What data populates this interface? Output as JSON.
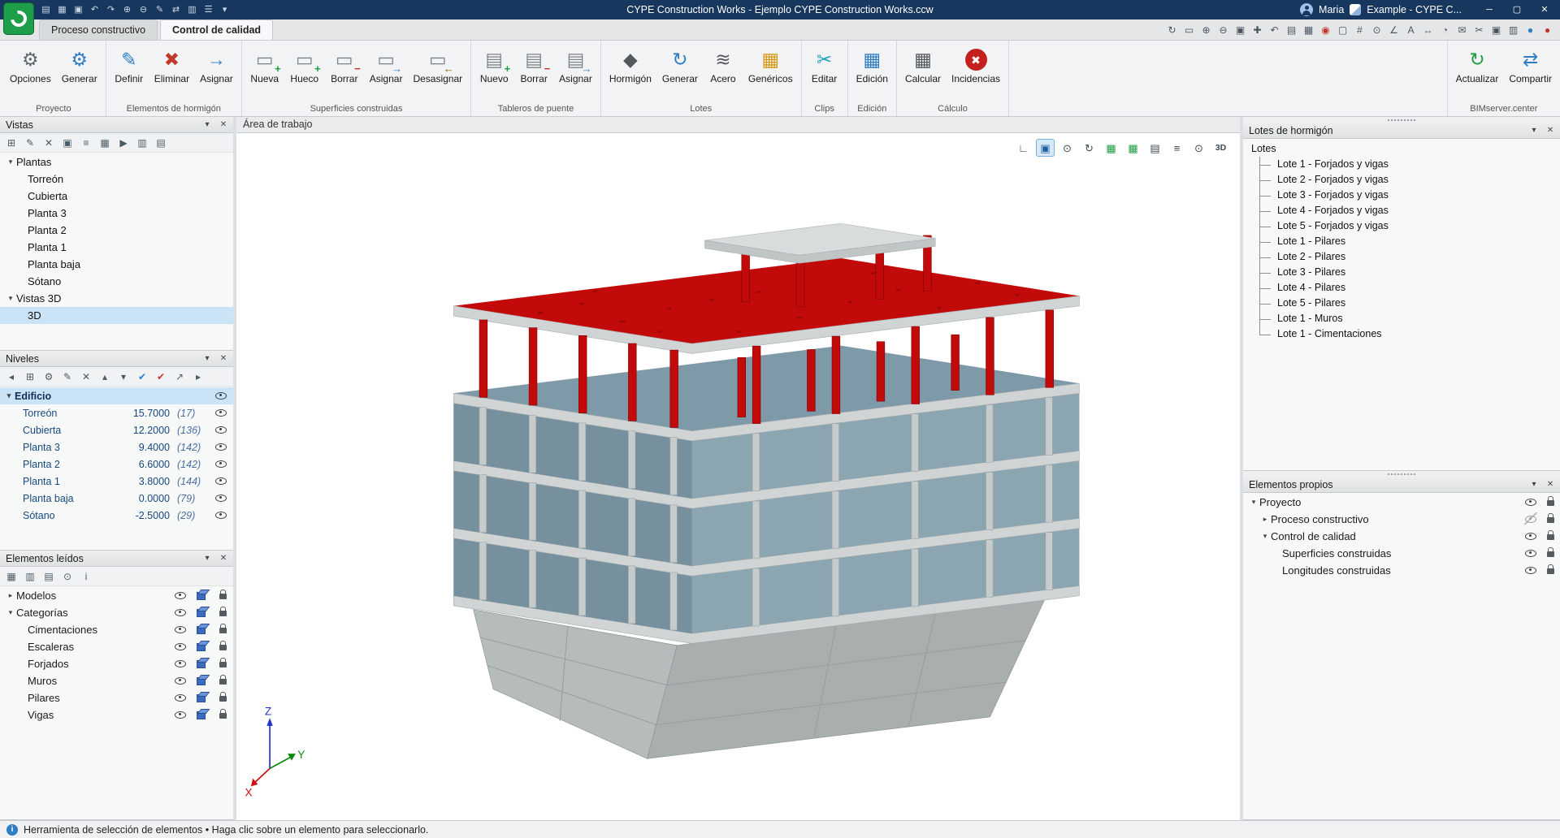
{
  "colors": {
    "titlebar": "#17375E",
    "accent": "#2F7DC3",
    "selection": "#CBE3F6",
    "building_red": "#C20A0A",
    "building_teal": "#7E99A7",
    "building_teal_light": "#8CA6B1",
    "slab_gray": "#D0D4D5",
    "tower_gray": "#D9DCDD"
  },
  "titlebar": {
    "title": "CYPE Construction Works - Ejemplo CYPE Construction Works.ccw",
    "user": "Maria",
    "session": "Example - CYPE C...",
    "quick_access": [
      {
        "name": "new-file-icon",
        "glyph": "▤"
      },
      {
        "name": "open-file-icon",
        "glyph": "▦"
      },
      {
        "name": "save-icon",
        "glyph": "▣"
      },
      {
        "name": "undo-icon",
        "glyph": "↶"
      },
      {
        "name": "redo-icon",
        "glyph": "↷"
      },
      {
        "name": "zoom-in-icon",
        "glyph": "⊕"
      },
      {
        "name": "zoom-out-icon",
        "glyph": "⊖"
      },
      {
        "name": "edit-icon",
        "glyph": "✎"
      },
      {
        "name": "link-icon",
        "glyph": "⇄"
      },
      {
        "name": "layout-icon",
        "glyph": "▥"
      },
      {
        "name": "menu-icon",
        "glyph": "☰"
      },
      {
        "name": "qat-dropdown-icon",
        "glyph": "▾"
      }
    ],
    "window_buttons": [
      {
        "name": "minimize-button",
        "glyph": "─"
      },
      {
        "name": "maximize-button",
        "glyph": "▢"
      },
      {
        "name": "close-button",
        "glyph": "✕"
      }
    ]
  },
  "tabs": [
    {
      "label": "Proceso constructivo",
      "active": false
    },
    {
      "label": "Control de calidad",
      "active": true
    }
  ],
  "tab_toolbar": [
    {
      "name": "orbit-icon",
      "glyph": "↻"
    },
    {
      "name": "zoom-window-icon",
      "glyph": "▭"
    },
    {
      "name": "zoom-in-icon",
      "glyph": "⊕"
    },
    {
      "name": "zoom-out-icon",
      "glyph": "⊖"
    },
    {
      "name": "zoom-all-icon",
      "glyph": "▣"
    },
    {
      "name": "pan-icon",
      "glyph": "✚"
    },
    {
      "name": "previous-view-icon",
      "glyph": "↶"
    },
    {
      "name": "print-icon",
      "glyph": "▤"
    },
    {
      "name": "capture-icon",
      "glyph": "▦"
    },
    {
      "name": "north-compass-icon",
      "glyph": "◉",
      "color": "#C0392B"
    },
    {
      "name": "frame-icon",
      "glyph": "▢"
    },
    {
      "name": "grid-icon",
      "glyph": "#"
    },
    {
      "name": "snap-icon",
      "glyph": "⊙"
    },
    {
      "name": "measure-icon",
      "glyph": "∠"
    },
    {
      "name": "text-icon",
      "glyph": "A"
    },
    {
      "name": "dimension-icon",
      "glyph": "↔"
    },
    {
      "name": "clock-icon",
      "glyph": "◔"
    },
    {
      "name": "comment-icon",
      "glyph": "✉"
    },
    {
      "name": "cut-icon",
      "glyph": "✂"
    },
    {
      "name": "windows-icon",
      "glyph": "▣"
    },
    {
      "name": "panels-icon",
      "glyph": "▥"
    },
    {
      "name": "globe-icon",
      "glyph": "●",
      "color": "#2F7DC3"
    },
    {
      "name": "bim-sphere-icon",
      "glyph": "●",
      "color": "#C0392B"
    }
  ],
  "ribbon": {
    "groups": [
      {
        "name": "Proyecto",
        "buttons": [
          {
            "label": "Opciones",
            "icon": "options"
          },
          {
            "label": "Generar",
            "icon": "generate-project"
          }
        ]
      },
      {
        "name": "Elementos de hormigón",
        "buttons": [
          {
            "label": "Definir",
            "icon": "define"
          },
          {
            "label": "Eliminar",
            "icon": "delete-element"
          },
          {
            "label": "Asignar",
            "icon": "assign-element"
          }
        ]
      },
      {
        "name": "Superficies construidas",
        "buttons": [
          {
            "label": "Nueva",
            "icon": "new-surface"
          },
          {
            "label": "Hueco",
            "icon": "hole-surface"
          },
          {
            "label": "Borrar",
            "icon": "delete-surface"
          },
          {
            "label": "Asignar",
            "icon": "assign-surface"
          },
          {
            "label": "Desasignar",
            "icon": "unassign-surface"
          }
        ]
      },
      {
        "name": "Tableros de puente",
        "buttons": [
          {
            "label": "Nuevo",
            "icon": "new-deck"
          },
          {
            "label": "Borrar",
            "icon": "delete-deck"
          },
          {
            "label": "Asignar",
            "icon": "assign-deck"
          }
        ]
      },
      {
        "name": "Lotes",
        "buttons": [
          {
            "label": "Hormigón",
            "icon": "concrete"
          },
          {
            "label": "Generar",
            "icon": "generate-lots"
          },
          {
            "label": "Acero",
            "icon": "steel"
          },
          {
            "label": "Genéricos",
            "icon": "generic"
          }
        ]
      },
      {
        "name": "Clips",
        "buttons": [
          {
            "label": "Editar",
            "icon": "edit-clips"
          }
        ]
      },
      {
        "name": "Edición",
        "buttons": [
          {
            "label": "Edición",
            "icon": "edition"
          }
        ]
      },
      {
        "name": "Cálculo",
        "buttons": [
          {
            "label": "Calcular",
            "icon": "calculate"
          },
          {
            "label": "Incidencias",
            "icon": "incidents"
          }
        ]
      },
      {
        "name": "BIMserver.center",
        "align_right": true,
        "buttons": [
          {
            "label": "Actualizar",
            "icon": "update"
          },
          {
            "label": "Compartir",
            "icon": "share"
          }
        ]
      }
    ]
  },
  "panels": {
    "vistas": {
      "title": "Vistas",
      "toolbar": [
        {
          "name": "new-view-icon",
          "glyph": "⊞"
        },
        {
          "name": "edit-view-icon",
          "glyph": "✎"
        },
        {
          "name": "delete-view-icon",
          "glyph": "✕"
        },
        {
          "name": "duplicate-view-icon",
          "glyph": "▣"
        },
        {
          "name": "sort-views-icon",
          "glyph": "≡"
        },
        {
          "name": "camera-icon",
          "glyph": "▦"
        },
        {
          "name": "animation-icon",
          "glyph": "▶"
        },
        {
          "name": "split-view-icon",
          "glyph": "▥"
        },
        {
          "name": "export-view-icon",
          "glyph": "▤"
        }
      ],
      "tree": [
        {
          "label": "Plantas",
          "level": 0,
          "chevron": "expanded"
        },
        {
          "label": "Torreón",
          "level": 1
        },
        {
          "label": "Cubierta",
          "level": 1
        },
        {
          "label": "Planta 3",
          "level": 1
        },
        {
          "label": "Planta 2",
          "level": 1
        },
        {
          "label": "Planta 1",
          "level": 1
        },
        {
          "label": "Planta baja",
          "level": 1
        },
        {
          "label": "Sótano",
          "level": 1
        },
        {
          "label": "Vistas 3D",
          "level": 0,
          "chevron": "expanded"
        },
        {
          "label": "3D",
          "level": 1,
          "selected": true
        }
      ]
    },
    "niveles": {
      "title": "Niveles",
      "toolbar": [
        {
          "name": "scroll-left-icon",
          "glyph": "◂"
        },
        {
          "name": "tree-levels-icon",
          "glyph": "⊞"
        },
        {
          "name": "settings-icon",
          "glyph": "⚙"
        },
        {
          "name": "edit-level-icon",
          "glyph": "✎"
        },
        {
          "name": "delete-level-icon",
          "glyph": "✕"
        },
        {
          "name": "move-up-icon",
          "glyph": "▴"
        },
        {
          "name": "move-down-icon",
          "glyph": "▾"
        },
        {
          "name": "check-all-icon",
          "glyph": "✔",
          "color": "#2F7DC3"
        },
        {
          "name": "uncheck-all-icon",
          "glyph": "✔",
          "color": "#C0392B"
        },
        {
          "name": "isolate-level-icon",
          "glyph": "↗"
        },
        {
          "name": "scroll-right-icon",
          "glyph": "▸"
        }
      ],
      "root": {
        "label": "Edificio"
      },
      "rows": [
        {
          "name": "Torreón",
          "elevation": "15.7000",
          "count": "(17)"
        },
        {
          "name": "Cubierta",
          "elevation": "12.2000",
          "count": "(136)"
        },
        {
          "name": "Planta 3",
          "elevation": "9.4000",
          "count": "(142)"
        },
        {
          "name": "Planta 2",
          "elevation": "6.6000",
          "count": "(142)"
        },
        {
          "name": "Planta 1",
          "elevation": "3.8000",
          "count": "(144)"
        },
        {
          "name": "Planta baja",
          "elevation": "0.0000",
          "count": "(79)"
        },
        {
          "name": "Sótano",
          "elevation": "-2.5000",
          "count": "(29)"
        }
      ]
    },
    "elementos_leidos": {
      "title": "Elementos leídos",
      "toolbar": [
        {
          "name": "group-by-model-icon",
          "glyph": "▦"
        },
        {
          "name": "group-by-category-icon",
          "glyph": "▥"
        },
        {
          "name": "expand-tree-icon",
          "glyph": "▤"
        },
        {
          "name": "visibility-all-icon",
          "glyph": "⊙"
        },
        {
          "name": "info-icon",
          "glyph": "i"
        }
      ],
      "tree": [
        {
          "label": "Modelos",
          "level": 0,
          "chevron": "collapsed"
        },
        {
          "label": "Categorías",
          "level": 0,
          "chevron": "expanded"
        },
        {
          "label": "Cimentaciones",
          "level": 1
        },
        {
          "label": "Escaleras",
          "level": 1
        },
        {
          "label": "Forjados",
          "level": 1
        },
        {
          "label": "Muros",
          "level": 1
        },
        {
          "label": "Pilares",
          "level": 1
        },
        {
          "label": "Vigas",
          "level": 1
        }
      ]
    },
    "lotes_hormigon": {
      "title": "Lotes de hormigón",
      "root": "Lotes",
      "items": [
        "Lote 1 - Forjados y vigas",
        "Lote 2 - Forjados y vigas",
        "Lote 3 - Forjados y vigas",
        "Lote 4 - Forjados y vigas",
        "Lote 5 - Forjados y vigas",
        "Lote 1 - Pilares",
        "Lote 2 - Pilares",
        "Lote 3 - Pilares",
        "Lote 4 - Pilares",
        "Lote 5 - Pilares",
        "Lote 1 - Muros",
        "Lote 1 - Cimentaciones"
      ]
    },
    "elementos_propios": {
      "title": "Elementos propios",
      "tree": [
        {
          "label": "Proyecto",
          "level": 0,
          "chevron": "expanded",
          "visible": true,
          "locked": true
        },
        {
          "label": "Proceso constructivo",
          "level": 1,
          "chevron": "collapsed",
          "visible": false,
          "locked": true
        },
        {
          "label": "Control de calidad",
          "level": 1,
          "chevron": "expanded",
          "visible": true,
          "locked": true
        },
        {
          "label": "Superficies construidas",
          "level": 2,
          "visible": true,
          "locked": true
        },
        {
          "label": "Longitudes construidas",
          "level": 2,
          "visible": true,
          "locked": true
        }
      ]
    }
  },
  "work_area": {
    "title": "Área de trabajo",
    "view_toolbar": [
      {
        "name": "workplane-icon",
        "glyph": "∟"
      },
      {
        "name": "view-3d-icon",
        "glyph": "▣",
        "active": true
      },
      {
        "name": "visibility-icon",
        "glyph": "⊙"
      },
      {
        "name": "orbit-icon",
        "glyph": "↻"
      },
      {
        "name": "analysis-icon",
        "glyph": "▦",
        "color": "#1E9E3E"
      },
      {
        "name": "check-grid-icon",
        "glyph": "▦",
        "color": "#1E9E3E"
      },
      {
        "name": "table-icon",
        "glyph": "▤"
      },
      {
        "name": "layers-icon",
        "glyph": "≡"
      },
      {
        "name": "ghost-view-icon",
        "glyph": "⊙"
      },
      {
        "name": "label-3d",
        "glyph": "3D",
        "text": true
      }
    ],
    "axis": {
      "x": "X",
      "y": "Y",
      "z": "Z"
    }
  },
  "status_bar": {
    "text": "Herramienta de selección de elementos  •  Haga clic sobre un elemento para seleccionarlo."
  }
}
